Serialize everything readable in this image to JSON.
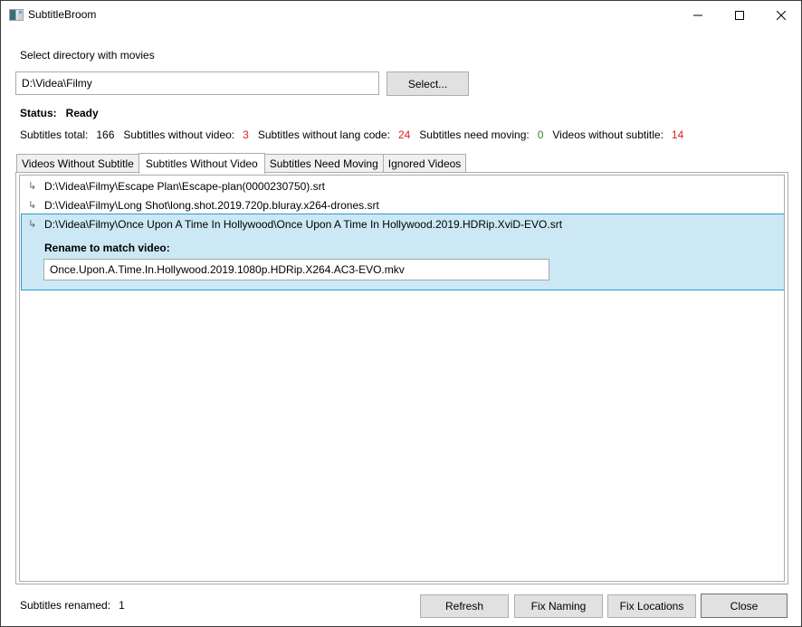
{
  "window": {
    "title": "SubtitleBroom",
    "controls": {
      "minimize": "minimize-icon",
      "maximize": "maximize-icon",
      "close": "close-icon"
    }
  },
  "directory": {
    "label": "Select directory with movies",
    "value": "D:\\Videa\\Filmy",
    "select_button": "Select..."
  },
  "status": {
    "label": "Status:",
    "value": "Ready"
  },
  "stats": [
    {
      "label": "Subtitles total:",
      "value": "166",
      "color": "#000000"
    },
    {
      "label": "Subtitles without video:",
      "value": "3",
      "color": "#e01b1b"
    },
    {
      "label": "Subtitles without lang code:",
      "value": "24",
      "color": "#e01b1b"
    },
    {
      "label": "Subtitles need moving:",
      "value": "0",
      "color": "#2e8b2e"
    },
    {
      "label": "Videos without subtitle:",
      "value": "14",
      "color": "#e01b1b"
    }
  ],
  "tabs": [
    {
      "label": "Videos Without Subtitle",
      "active": false
    },
    {
      "label": "Subtitles Without Video",
      "active": true
    },
    {
      "label": "Subtitles Need Moving",
      "active": false
    },
    {
      "label": "Ignored Videos",
      "active": false
    }
  ],
  "list": {
    "item_icon": "subdirectory-arrow-icon",
    "items": [
      {
        "path": "D:\\Videa\\Filmy\\Escape Plan\\Escape-plan(0000230750).srt"
      },
      {
        "path": "D:\\Videa\\Filmy\\Long Shot\\long.shot.2019.720p.bluray.x264-drones.srt"
      },
      {
        "path": "D:\\Videa\\Filmy\\Once Upon A Time In Hollywood\\Once Upon A Time In Hollywood.2019.HDRip.XviD-EVO.srt",
        "selected": true,
        "rename_label": "Rename to match video:",
        "rename_value": "Once.Upon.A.Time.In.Hollywood.2019.1080p.HDRip.X264.AC3-EVO.mkv"
      }
    ]
  },
  "footer": {
    "renamed_label": "Subtitles renamed:",
    "renamed_value": "1",
    "buttons": {
      "refresh": "Refresh",
      "fix_naming": "Fix Naming",
      "fix_locations": "Fix Locations",
      "close": "Close"
    }
  },
  "colors": {
    "selection_bg": "#cce8f5",
    "selection_border": "#2a9bd3",
    "error": "#e01b1b",
    "ok": "#2e8b2e"
  }
}
